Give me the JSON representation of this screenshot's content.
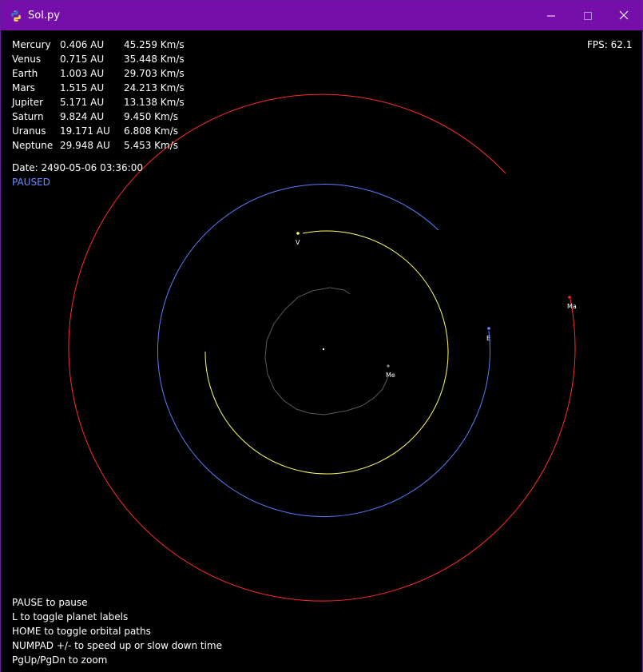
{
  "window": {
    "title": "Sol.py"
  },
  "hud": {
    "planets": [
      {
        "name": "Mercury",
        "distance": "0.406 AU",
        "velocity": "45.259 Km/s"
      },
      {
        "name": "Venus",
        "distance": "0.715 AU",
        "velocity": "35.448 Km/s"
      },
      {
        "name": "Earth",
        "distance": "1.003 AU",
        "velocity": "29.703 Km/s"
      },
      {
        "name": "Mars",
        "distance": "1.515 AU",
        "velocity": "24.213 Km/s"
      },
      {
        "name": "Jupiter",
        "distance": "5.171 AU",
        "velocity": "13.138 Km/s"
      },
      {
        "name": "Saturn",
        "distance": "9.824 AU",
        "velocity": "9.450 Km/s"
      },
      {
        "name": "Uranus",
        "distance": "19.171 AU",
        "velocity": "6.808 Km/s"
      },
      {
        "name": "Neptune",
        "distance": "29.948 AU",
        "velocity": "5.453 Km/s"
      }
    ],
    "date": "Date: 2490-05-06 03:36:00",
    "status": "PAUSED",
    "fps": "FPS: 62.1"
  },
  "help": [
    "PAUSE to pause",
    "L to toggle planet labels",
    "HOME to toggle orbital paths",
    "NUMPAD +/- to speed up or slow down time",
    "PgUp/PgDn to zoom"
  ],
  "planet_labels": {
    "mercury": "Me",
    "venus": "V",
    "earth": "E",
    "mars": "Ma"
  },
  "colors": {
    "titlebar": "#760eaa",
    "mercury_orbit": "#5a5a5a",
    "venus_orbit": "#ffff66",
    "earth_orbit": "#5a7dff",
    "mars_orbit": "#ff2a2a",
    "sun": "#ffffff",
    "paused_text": "#6b8cff"
  },
  "icons": {
    "app": "python-icon",
    "minimize": "minimize-icon",
    "maximize": "maximize-icon",
    "close": "close-icon"
  }
}
